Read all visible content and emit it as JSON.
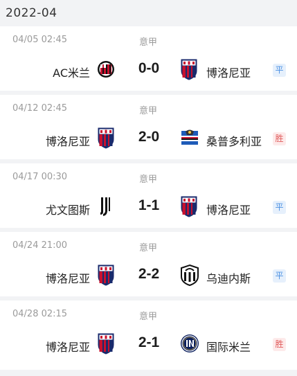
{
  "month": "2022-04",
  "colors": {
    "draw_badge_text": "#4a90e2",
    "win_badge_text": "#e05a5a"
  },
  "matches": [
    {
      "date": "04/05  02:45",
      "league": "意甲",
      "home": {
        "name": "AC米兰",
        "logo": "ac-milan-crest-icon"
      },
      "score": "0-0",
      "away": {
        "name": "博洛尼亚",
        "logo": "bologna-crest-icon"
      },
      "result": "平",
      "result_type": "draw"
    },
    {
      "date": "04/12  02:45",
      "league": "意甲",
      "home": {
        "name": "博洛尼亚",
        "logo": "bologna-crest-icon"
      },
      "score": "2-0",
      "away": {
        "name": "桑普多利亚",
        "logo": "sampdoria-crest-icon"
      },
      "result": "胜",
      "result_type": "win"
    },
    {
      "date": "04/17  00:30",
      "league": "意甲",
      "home": {
        "name": "尤文图斯",
        "logo": "juventus-crest-icon"
      },
      "score": "1-1",
      "away": {
        "name": "博洛尼亚",
        "logo": "bologna-crest-icon"
      },
      "result": "平",
      "result_type": "draw"
    },
    {
      "date": "04/24  21:00",
      "league": "意甲",
      "home": {
        "name": "博洛尼亚",
        "logo": "bologna-crest-icon"
      },
      "score": "2-2",
      "away": {
        "name": "乌迪内斯",
        "logo": "udinese-crest-icon"
      },
      "result": "平",
      "result_type": "draw"
    },
    {
      "date": "04/28  02:15",
      "league": "意甲",
      "home": {
        "name": "博洛尼亚",
        "logo": "bologna-crest-icon"
      },
      "score": "2-1",
      "away": {
        "name": "国际米兰",
        "logo": "inter-milan-crest-icon"
      },
      "result": "胜",
      "result_type": "win"
    }
  ]
}
